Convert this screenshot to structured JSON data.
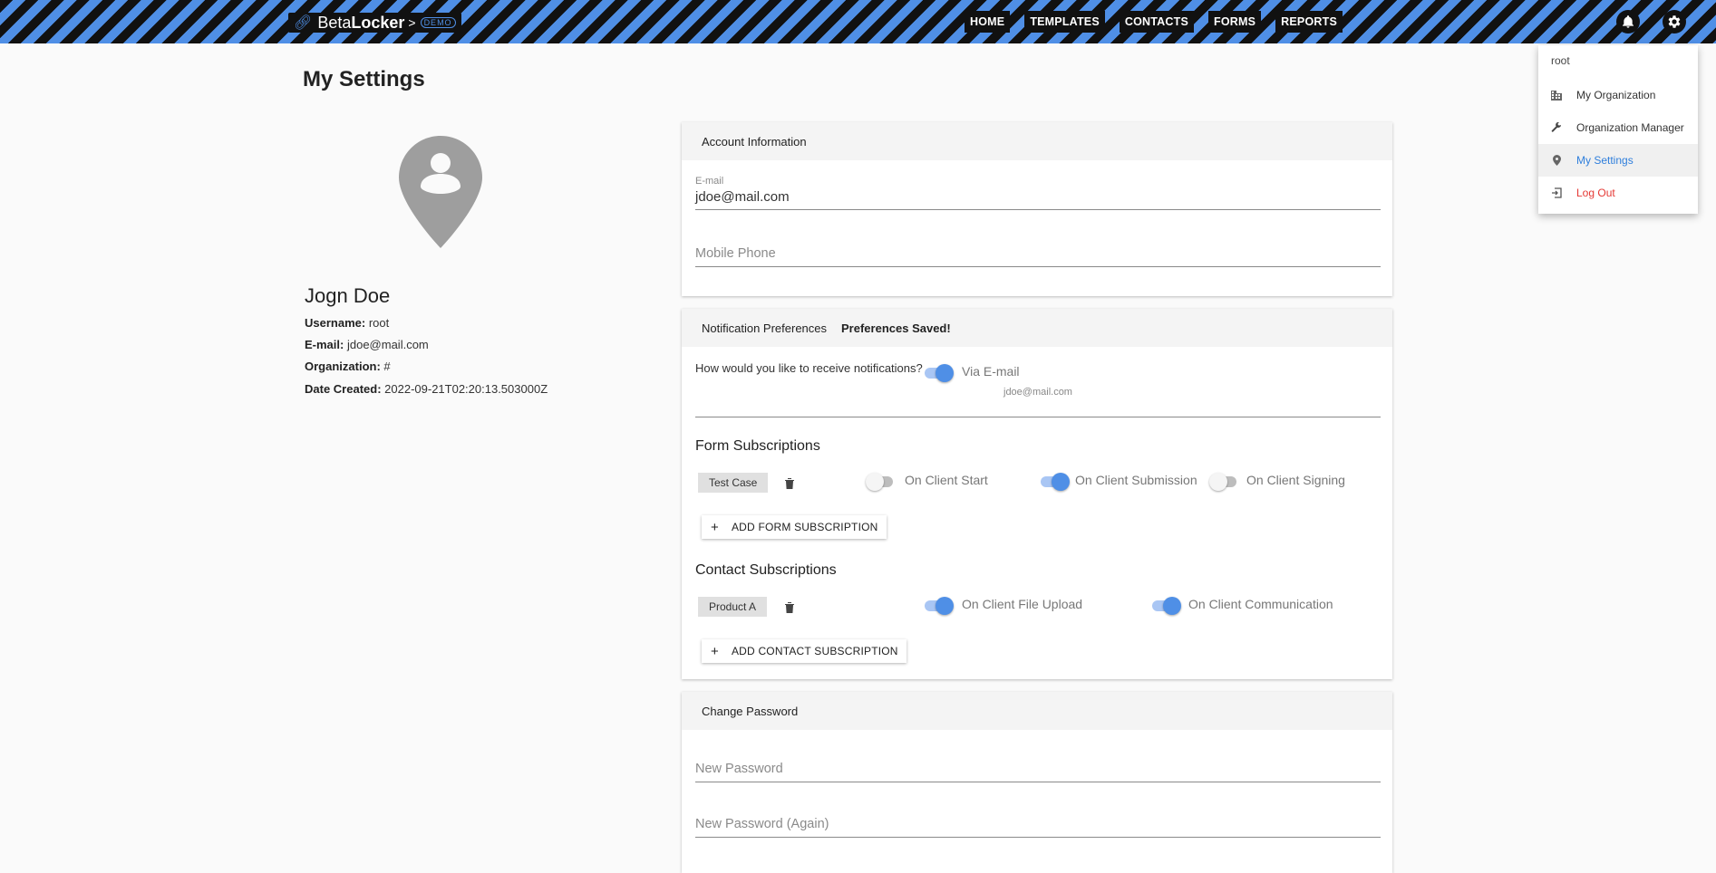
{
  "header": {
    "logo_icon": "link-icon",
    "brand_part1": "Beta",
    "brand_part2": "Locker",
    "brand_separator": ">",
    "brand_badge": "DEMO",
    "nav": [
      "HOME",
      "TEMPLATES",
      "CONTACTS",
      "FORMS",
      "REPORTS"
    ],
    "icons": [
      "bell-icon",
      "gear-icon"
    ],
    "stripe_colors": [
      "#111111",
      "#4f8fe6"
    ]
  },
  "page": {
    "title": "My Settings"
  },
  "profile": {
    "avatar_icon": "user-location-pin-icon",
    "name": "Jogn Doe",
    "username_label": "Username:",
    "username": "root",
    "email_label": "E-mail:",
    "email": "jdoe@mail.com",
    "org_label": "Organization:",
    "org": "#",
    "created_label": "Date Created:",
    "created": "2022-09-21T02:20:13.503000Z"
  },
  "account": {
    "title": "Account Information",
    "email_label": "E-mail",
    "email_value": "jdoe@mail.com",
    "mobile_placeholder": "Mobile Phone"
  },
  "notifications": {
    "title": "Notification Preferences",
    "saved": "Preferences Saved!",
    "question": "How would you like to receive notifications?",
    "via_email_label": "Via E-mail",
    "via_email_on": true,
    "email_hint": "jdoe@mail.com",
    "form_subs": {
      "title": "Form Subscriptions",
      "item": "Test Case",
      "toggles": [
        {
          "label": "On Client Start",
          "on": false
        },
        {
          "label": "On Client Submission",
          "on": true
        },
        {
          "label": "On Client Signing",
          "on": false
        }
      ],
      "add_label": "ADD FORM SUBSCRIPTION"
    },
    "contact_subs": {
      "title": "Contact Subscriptions",
      "item": "Product A",
      "toggles": [
        {
          "label": "On Client File Upload",
          "on": true
        },
        {
          "label": "On Client Communication",
          "on": true
        }
      ],
      "add_label": "ADD CONTACT SUBSCRIPTION"
    }
  },
  "password": {
    "title": "Change Password",
    "new_placeholder": "New Password",
    "again_placeholder": "New Password (Again)"
  },
  "menu": {
    "user": "root",
    "items": [
      {
        "label": "My Organization",
        "icon": "building-icon"
      },
      {
        "label": "Organization Manager",
        "icon": "wrench-icon"
      },
      {
        "label": "My Settings",
        "icon": "location-pin-icon"
      },
      {
        "label": "Log Out",
        "icon": "logout-icon"
      }
    ]
  },
  "colors": {
    "accent": "#4f8fe6",
    "active_menu": "#2f7fdc",
    "logout": "#e53935"
  }
}
